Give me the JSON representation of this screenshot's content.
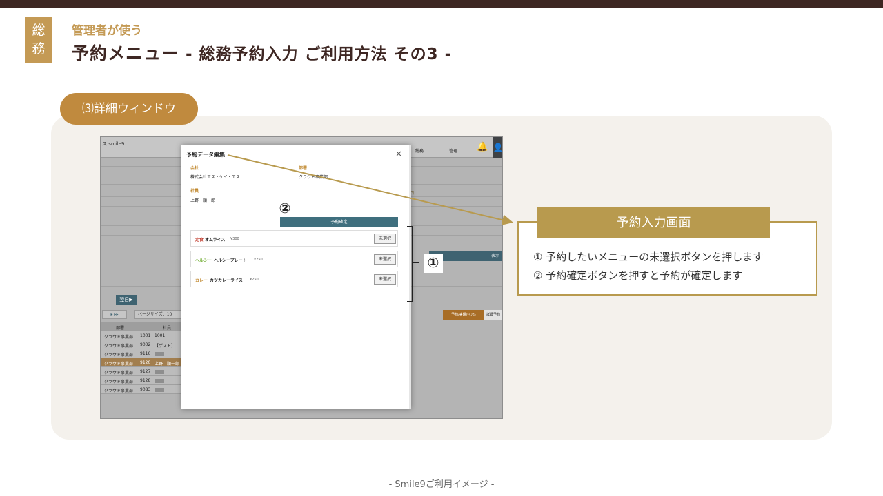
{
  "header": {
    "badge": "総\n務",
    "subtitle": "管理者が使う",
    "title_main": "予約メニュー",
    "title_tail": " - 総務予約入力 ご利用方法 その3 -"
  },
  "section_label": "⑶詳細ウィンドウ",
  "app": {
    "brand": "ス smile9",
    "nav": [
      "総務",
      "管理"
    ],
    "right_label": "門",
    "show_button": "表示",
    "next_day_button": "翌日▶",
    "pager": "▸ ▸▸",
    "page_size": "ページサイズ：10",
    "tabs": [
      "予約/実績/ｷｬﾝｾﾙ",
      "詳細予約"
    ],
    "table": {
      "headers": [
        "部署",
        "社員"
      ],
      "rows": [
        {
          "dept": "クラウド事業部",
          "code": "1001",
          "name": "1001",
          "selected": false
        },
        {
          "dept": "クラウド事業部",
          "code": "9002",
          "name": "【ゲスト】",
          "selected": false
        },
        {
          "dept": "クラウド事業部",
          "code": "9116",
          "name": "",
          "selected": false
        },
        {
          "dept": "クラウド事業部",
          "code": "9120",
          "name": "上野　順一郎",
          "selected": true
        },
        {
          "dept": "クラウド事業部",
          "code": "9127",
          "name": "",
          "selected": false
        },
        {
          "dept": "クラウド事業部",
          "code": "9128",
          "name": "",
          "selected": false
        },
        {
          "dept": "クラウド事業部",
          "code": "9083",
          "name": "",
          "selected": false
        }
      ]
    }
  },
  "modal": {
    "title": "予約データ編集",
    "close": "×",
    "company_label": "会社",
    "company_value": "株式会社エス・ケイ・エス",
    "dept_label": "部署",
    "dept_value": "クラウド事業部",
    "employee_label": "社員",
    "employee_value": "上野　順一郎",
    "confirm_button": "予約確定",
    "menu_items": [
      {
        "category": "定食",
        "category_color": "#c0392b",
        "name": "オムライス",
        "price": "¥300",
        "button": "未選択"
      },
      {
        "category": "ヘルシー",
        "category_color": "#7cb342",
        "name": "ヘルシープレート",
        "price": "¥250",
        "button": "未選択"
      },
      {
        "category": "カレー",
        "category_color": "#c0882e",
        "name": "カツカレーライス",
        "price": "¥250",
        "button": "未選択"
      }
    ]
  },
  "annotations": {
    "num1": "①",
    "num2": "②"
  },
  "info": {
    "heading": "予約入力画面",
    "line1": "① 予約したいメニューの未選択ボタンを押します",
    "line2": "② 予約確定ボタンを押すと予約が確定します"
  },
  "footer": "- Smile9ご利用イメージ -",
  "colors": {
    "accent_gold": "#c49a55",
    "dark_brown": "#3e2723",
    "info_gold": "#b89a4e"
  }
}
